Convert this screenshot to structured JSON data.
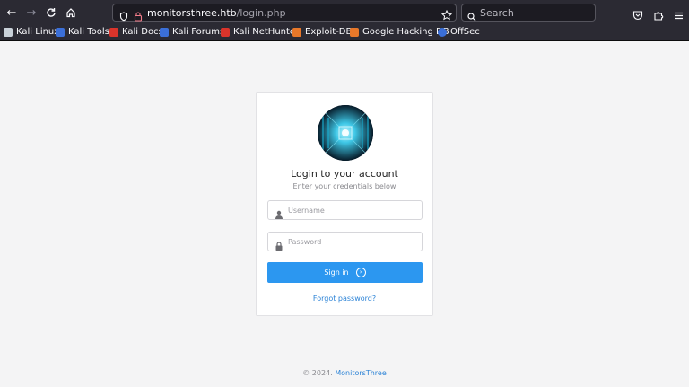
{
  "browser": {
    "url_host": "monitorsthree.htb",
    "url_path": "/login.php",
    "search_placeholder": "Search",
    "bookmarks": [
      {
        "label": "Kali Linux",
        "color": "#c9d1d9"
      },
      {
        "label": "Kali Tools",
        "color": "#3b6fd8"
      },
      {
        "label": "Kali Docs",
        "color": "#d9342b"
      },
      {
        "label": "Kali Forums",
        "color": "#3b6fd8"
      },
      {
        "label": "Kali NetHunter",
        "color": "#d9342b"
      },
      {
        "label": "Exploit-DB",
        "color": "#e8782a"
      },
      {
        "label": "Google Hacking DB",
        "color": "#e8782a"
      },
      {
        "label": "OffSec",
        "color": "#3b6fd8"
      }
    ]
  },
  "login": {
    "title": "Login to your account",
    "subtitle": "Enter your credentials below",
    "username_placeholder": "Username",
    "password_placeholder": "Password",
    "signin_label": "Sign in",
    "forgot_label": "Forgot password?"
  },
  "footer": {
    "copyright": "© 2024.",
    "brand": "MonitorsThree"
  },
  "colors": {
    "accent": "#2c97f0",
    "link": "#2c83d6",
    "chrome": "#2b2a33"
  }
}
